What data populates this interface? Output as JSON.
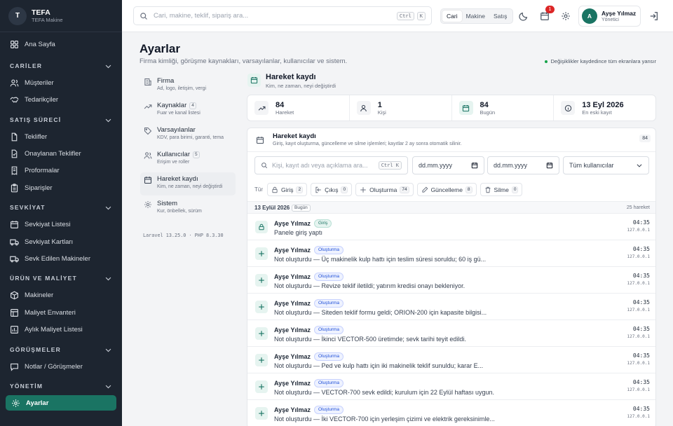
{
  "brand": {
    "logo": "T",
    "name": "TEFA",
    "sub": "TEFA Makine"
  },
  "sidebar": {
    "home": "Ana Sayfa",
    "sections": [
      {
        "title": "CARİLER",
        "items": [
          "Müşteriler",
          "Tedarikçiler"
        ]
      },
      {
        "title": "SATIŞ SÜRECİ",
        "items": [
          "Teklifler",
          "Onaylanan Teklifler",
          "Proformalar",
          "Siparişler"
        ]
      },
      {
        "title": "SEVKİYAT",
        "items": [
          "Sevkiyat Listesi",
          "Sevkiyat Kartları",
          "Sevk Edilen Makineler"
        ]
      },
      {
        "title": "ÜRÜN VE MALİYET",
        "items": [
          "Makineler",
          "Maliyet Envanteri",
          "Aylık Maliyet Listesi"
        ]
      },
      {
        "title": "GÖRÜŞMELER",
        "items": [
          "Notlar / Görüşmeler"
        ]
      },
      {
        "title": "YÖNETİM",
        "items": [
          "Ayarlar"
        ]
      }
    ]
  },
  "topbar": {
    "search_placeholder": "Cari, makine, teklif, sipariş ara...",
    "kbd1": "Ctrl",
    "kbd2": "K",
    "scope": [
      "Cari",
      "Makine",
      "Satış"
    ],
    "notif_count": "1",
    "user_initial": "A",
    "user_name": "Ayşe Yılmaz",
    "user_role": "Yönetici"
  },
  "page": {
    "title": "Ayarlar",
    "subtitle": "Firma kimliği, görüşme kaynakları, varsayılanlar, kullanıcılar ve sistem.",
    "note": "Değişiklikler kaydedince tüm ekranlara yansır"
  },
  "settings_nav": [
    {
      "title": "Firma",
      "desc": "Ad, logo, iletişim, vergi",
      "count": ""
    },
    {
      "title": "Kaynaklar",
      "desc": "Fuar ve kanal listesi",
      "count": "4"
    },
    {
      "title": "Varsayılanlar",
      "desc": "KDV, para birimi, garanti, tema",
      "count": ""
    },
    {
      "title": "Kullanıcılar",
      "desc": "Erişim ve roller",
      "count": "5"
    },
    {
      "title": "Hareket kaydı",
      "desc": "Kim, ne zaman, neyi değiştirdi",
      "count": ""
    },
    {
      "title": "Sistem",
      "desc": "Kur, önbellek, sürüm",
      "count": ""
    }
  ],
  "version": "Laravel 13.25.0 · PHP 8.3.30",
  "content": {
    "title": "Hareket kaydı",
    "subtitle": "Kim, ne zaman, neyi değiştirdi",
    "stats": [
      {
        "value": "84",
        "label": "Hareket"
      },
      {
        "value": "1",
        "label": "Kişi"
      },
      {
        "value": "84",
        "label": "Bugün"
      },
      {
        "value": "13 Eyl 2026",
        "label": "En eski kayıt"
      }
    ],
    "panel_title": "Hareket kaydı",
    "panel_sub": "Giriş, kayıt oluşturma, güncelleme ve silme işlemleri; kayıtlar 2 ay sonra otomatik silinir.",
    "panel_count": "84",
    "filter_placeholder": "Kişi, kayıt adı veya açıklama ara...",
    "date_from": "dd.mm.yyyy",
    "date_to": "dd.mm.yyyy",
    "user_select": "Tüm kullanıcılar",
    "type_label": "Tür",
    "chips": [
      {
        "label": "Giriş",
        "n": "2"
      },
      {
        "label": "Çıkış",
        "n": "0"
      },
      {
        "label": "Oluşturma",
        "n": "74"
      },
      {
        "label": "Güncelleme",
        "n": "8"
      },
      {
        "label": "Silme",
        "n": "0"
      }
    ],
    "day": {
      "date": "13 Eylül 2026",
      "badge": "Bugün",
      "count": "25 hareket"
    },
    "events": [
      {
        "user": "Ayşe Yılmaz",
        "tag": "Giriş",
        "msg": "Panele giriş yaptı",
        "time": "04:35",
        "ip": "127.0.0.1"
      },
      {
        "user": "Ayşe Yılmaz",
        "tag": "Oluşturma",
        "msg": "Not oluşturdu — Üç makinelik kulp hattı için teslim süresi soruldu; 60 iş gü...",
        "time": "04:35",
        "ip": "127.0.0.1"
      },
      {
        "user": "Ayşe Yılmaz",
        "tag": "Oluşturma",
        "msg": "Not oluşturdu — Revize teklif iletildi; yatırım kredisi onayı bekleniyor.",
        "time": "04:35",
        "ip": "127.0.0.1"
      },
      {
        "user": "Ayşe Yılmaz",
        "tag": "Oluşturma",
        "msg": "Not oluşturdu — Siteden teklif formu geldi; ORION-200 için kapasite bilgisi...",
        "time": "04:35",
        "ip": "127.0.0.1"
      },
      {
        "user": "Ayşe Yılmaz",
        "tag": "Oluşturma",
        "msg": "Not oluşturdu — İkinci VECTOR-500 üretimde; sevk tarihi teyit edildi.",
        "time": "04:35",
        "ip": "127.0.0.1"
      },
      {
        "user": "Ayşe Yılmaz",
        "tag": "Oluşturma",
        "msg": "Not oluşturdu — Ped ve kulp hattı için iki makinelik teklif sunuldu; karar E...",
        "time": "04:35",
        "ip": "127.0.0.1"
      },
      {
        "user": "Ayşe Yılmaz",
        "tag": "Oluşturma",
        "msg": "Not oluşturdu — VECTOR-700 sevk edildi; kurulum için 22 Eylül haftası uygun.",
        "time": "04:35",
        "ip": "127.0.0.1"
      },
      {
        "user": "Ayşe Yılmaz",
        "tag": "Oluşturma",
        "msg": "Not oluşturdu — İki VECTOR-700 için yerleşim çizimi ve elektrik gereksinimle...",
        "time": "04:35",
        "ip": "127.0.0.1"
      }
    ]
  }
}
